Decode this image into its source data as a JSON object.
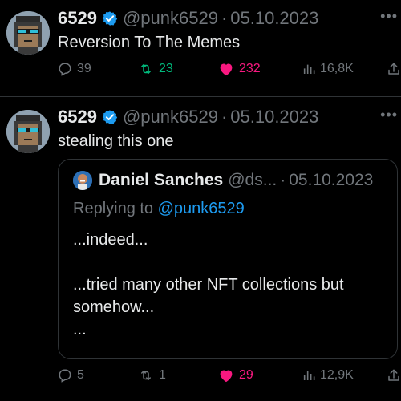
{
  "colors": {
    "background": "#000000",
    "text": "#e7e9ea",
    "muted": "#71767b",
    "accent": "#1d9bf0",
    "retweet": "#00ba7c",
    "like": "#f91880",
    "border": "#2f3336"
  },
  "tweets": [
    {
      "display_name": "6529",
      "handle": "@punk6529",
      "separator": "·",
      "date": "05.10.2023",
      "text": "Reversion To The Memes",
      "more": "•••",
      "replies": "39",
      "retweets": "23",
      "likes": "232",
      "views": "16,8K"
    },
    {
      "display_name": "6529",
      "handle": "@punk6529",
      "separator": "·",
      "date": "05.10.2023",
      "text": "stealing this one",
      "more": "•••",
      "quote": {
        "display_name": "Daniel Sanches",
        "handle": "@ds...",
        "separator": "·",
        "date": "05.10.2023",
        "replying_prefix": "Replying to ",
        "replying_to": "@punk6529",
        "lines": [
          "...indeed...",
          "",
          "...tried many other NFT collections but",
          "somehow...",
          "..."
        ]
      },
      "replies": "5",
      "retweets": "1",
      "likes": "29",
      "views": "12,9K"
    }
  ]
}
